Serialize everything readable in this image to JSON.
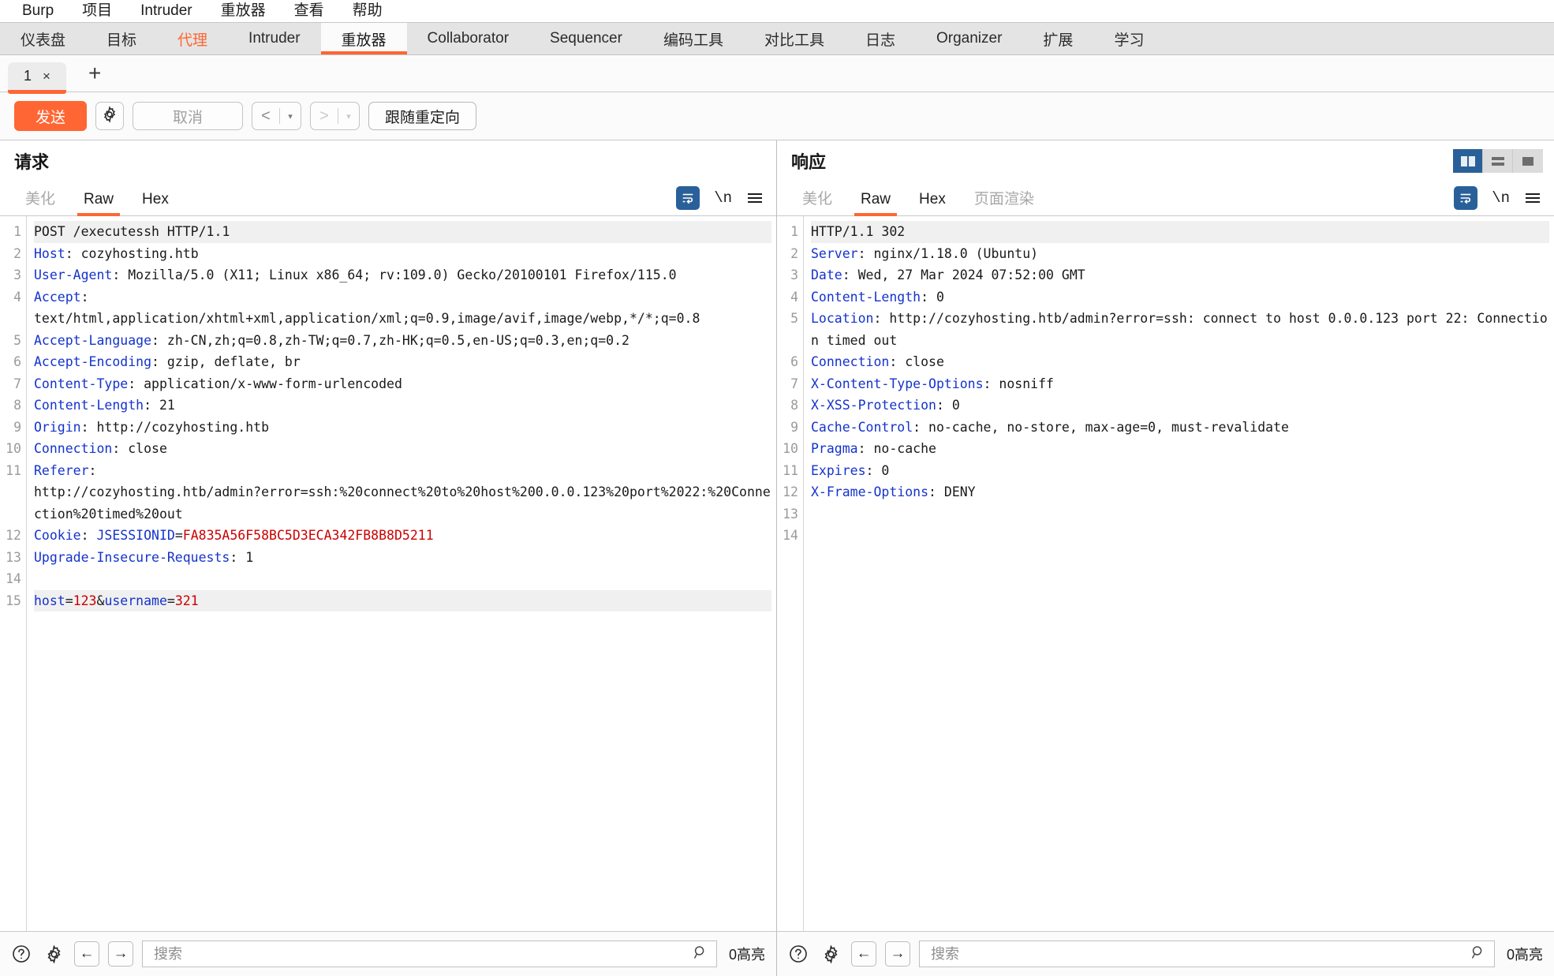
{
  "menubar": {
    "items": [
      {
        "label": "Burp"
      },
      {
        "label": "项目"
      },
      {
        "label": "Intruder"
      },
      {
        "label": "重放器"
      },
      {
        "label": "查看"
      },
      {
        "label": "帮助"
      }
    ]
  },
  "main_tabs": [
    {
      "label": "仪表盘",
      "state": "normal"
    },
    {
      "label": "目标",
      "state": "normal"
    },
    {
      "label": "代理",
      "state": "proxy"
    },
    {
      "label": "Intruder",
      "state": "normal"
    },
    {
      "label": "重放器",
      "state": "active"
    },
    {
      "label": "Collaborator",
      "state": "normal"
    },
    {
      "label": "Sequencer",
      "state": "normal"
    },
    {
      "label": "编码工具",
      "state": "normal"
    },
    {
      "label": "对比工具",
      "state": "normal"
    },
    {
      "label": "日志",
      "state": "normal"
    },
    {
      "label": "Organizer",
      "state": "normal"
    },
    {
      "label": "扩展",
      "state": "normal"
    },
    {
      "label": "学习",
      "state": "normal"
    }
  ],
  "repeater_tabs": {
    "tabs": [
      {
        "label": "1",
        "close": "×"
      }
    ],
    "add_label": "+"
  },
  "toolbar": {
    "send_label": "发送",
    "settings_icon": "gear-icon",
    "cancel_label": "取消",
    "back_caret": "▾",
    "forward_caret": "▾",
    "follow_redirect_label": "跟随重定向"
  },
  "request": {
    "title": "请求",
    "tabs": [
      {
        "label": "美化",
        "state": "muted"
      },
      {
        "label": "Raw",
        "state": "active"
      },
      {
        "label": "Hex",
        "state": "normal"
      }
    ],
    "tools": {
      "wrap_icon": "word-wrap-icon",
      "newline_label": "\\n",
      "menu_icon": "hamburger-menu-icon"
    },
    "lines": [
      {
        "n": "1",
        "hl": true,
        "parts": [
          {
            "t": "POST /executessh HTTP/1.1",
            "c": "val"
          }
        ]
      },
      {
        "n": "2",
        "parts": [
          {
            "t": "Host",
            "c": "hdr"
          },
          {
            "t": ": cozyhosting.htb",
            "c": "val"
          }
        ]
      },
      {
        "n": "3",
        "parts": [
          {
            "t": "User-Agent",
            "c": "hdr"
          },
          {
            "t": ": Mozilla/5.0 (X11; Linux x86_64; rv:109.0) Gecko/20100101 Firefox/115.0",
            "c": "val"
          }
        ]
      },
      {
        "n": "4",
        "parts": [
          {
            "t": "Accept",
            "c": "hdr"
          },
          {
            "t": ":\ntext/html,application/xhtml+xml,application/xml;q=0.9,image/avif,image/webp,*/*;q=0.8",
            "c": "val"
          }
        ]
      },
      {
        "n": "5",
        "parts": [
          {
            "t": "Accept-Language",
            "c": "hdr"
          },
          {
            "t": ": zh-CN,zh;q=0.8,zh-TW;q=0.7,zh-HK;q=0.5,en-US;q=0.3,en;q=0.2",
            "c": "val"
          }
        ]
      },
      {
        "n": "6",
        "parts": [
          {
            "t": "Accept-Encoding",
            "c": "hdr"
          },
          {
            "t": ": gzip, deflate, br",
            "c": "val"
          }
        ]
      },
      {
        "n": "7",
        "parts": [
          {
            "t": "Content-Type",
            "c": "hdr"
          },
          {
            "t": ": application/x-www-form-urlencoded",
            "c": "val"
          }
        ]
      },
      {
        "n": "8",
        "parts": [
          {
            "t": "Content-Length",
            "c": "hdr"
          },
          {
            "t": ": 21",
            "c": "val"
          }
        ]
      },
      {
        "n": "9",
        "parts": [
          {
            "t": "Origin",
            "c": "hdr"
          },
          {
            "t": ": http://cozyhosting.htb",
            "c": "val"
          }
        ]
      },
      {
        "n": "10",
        "parts": [
          {
            "t": "Connection",
            "c": "hdr"
          },
          {
            "t": ": close",
            "c": "val"
          }
        ]
      },
      {
        "n": "11",
        "parts": [
          {
            "t": "Referer",
            "c": "hdr"
          },
          {
            "t": ":\nhttp://cozyhosting.htb/admin?error=ssh:%20connect%20to%20host%200.0.0.123%20port%2022:%20Connection%20timed%20out",
            "c": "val"
          }
        ]
      },
      {
        "n": "12",
        "parts": [
          {
            "t": "Cookie",
            "c": "hdr"
          },
          {
            "t": ": ",
            "c": "val"
          },
          {
            "t": "JSESSIONID",
            "c": "blue"
          },
          {
            "t": "=",
            "c": "val"
          },
          {
            "t": "FA835A56F58BC5D3ECA342FB8B8D5211",
            "c": "red"
          }
        ]
      },
      {
        "n": "13",
        "parts": [
          {
            "t": "Upgrade-Insecure-Requests",
            "c": "hdr"
          },
          {
            "t": ": 1",
            "c": "val"
          }
        ]
      },
      {
        "n": "14",
        "parts": [
          {
            "t": "",
            "c": "val"
          }
        ]
      },
      {
        "n": "15",
        "hl": true,
        "parts": [
          {
            "t": "host",
            "c": "blue"
          },
          {
            "t": "=",
            "c": "val"
          },
          {
            "t": "123",
            "c": "red"
          },
          {
            "t": "&",
            "c": "val"
          },
          {
            "t": "username",
            "c": "blue"
          },
          {
            "t": "=",
            "c": "val"
          },
          {
            "t": "321",
            "c": "red"
          }
        ]
      }
    ],
    "status": {
      "help_icon": "help-icon",
      "settings_icon": "gear-icon",
      "prev_icon": "arrow-left-icon",
      "next_icon": "arrow-right-icon",
      "search_placeholder": "搜索",
      "search_value": "",
      "search_icon": "magnifier-icon",
      "highlight_count": "0高亮"
    }
  },
  "response": {
    "title": "响应",
    "view_modes": [
      {
        "name": "side-by-side-view",
        "state": "active"
      },
      {
        "name": "stacked-view",
        "state": "normal"
      },
      {
        "name": "single-view",
        "state": "normal"
      }
    ],
    "tabs": [
      {
        "label": "美化",
        "state": "muted"
      },
      {
        "label": "Raw",
        "state": "active"
      },
      {
        "label": "Hex",
        "state": "normal"
      },
      {
        "label": "页面渲染",
        "state": "muted"
      }
    ],
    "tools": {
      "wrap_icon": "word-wrap-icon",
      "newline_label": "\\n",
      "menu_icon": "hamburger-menu-icon"
    },
    "lines": [
      {
        "n": "1",
        "hl": true,
        "parts": [
          {
            "t": "HTTP/1.1 302",
            "c": "val"
          }
        ]
      },
      {
        "n": "2",
        "parts": [
          {
            "t": "Server",
            "c": "hdr"
          },
          {
            "t": ": nginx/1.18.0 (Ubuntu)",
            "c": "val"
          }
        ]
      },
      {
        "n": "3",
        "parts": [
          {
            "t": "Date",
            "c": "hdr"
          },
          {
            "t": ": Wed, 27 Mar 2024 07:52:00 GMT",
            "c": "val"
          }
        ]
      },
      {
        "n": "4",
        "parts": [
          {
            "t": "Content-Length",
            "c": "hdr"
          },
          {
            "t": ": 0",
            "c": "val"
          }
        ]
      },
      {
        "n": "5",
        "parts": [
          {
            "t": "Location",
            "c": "hdr"
          },
          {
            "t": ": http://cozyhosting.htb/admin?error=ssh: connect to host 0.0.0.123 port 22: Connection timed out",
            "c": "val"
          }
        ]
      },
      {
        "n": "6",
        "parts": [
          {
            "t": "Connection",
            "c": "hdr"
          },
          {
            "t": ": close",
            "c": "val"
          }
        ]
      },
      {
        "n": "7",
        "parts": [
          {
            "t": "X-Content-Type-Options",
            "c": "hdr"
          },
          {
            "t": ": nosniff",
            "c": "val"
          }
        ]
      },
      {
        "n": "8",
        "parts": [
          {
            "t": "X-XSS-Protection",
            "c": "hdr"
          },
          {
            "t": ": 0",
            "c": "val"
          }
        ]
      },
      {
        "n": "9",
        "parts": [
          {
            "t": "Cache-Control",
            "c": "hdr"
          },
          {
            "t": ": no-cache, no-store, max-age=0, must-revalidate",
            "c": "val"
          }
        ]
      },
      {
        "n": "10",
        "parts": [
          {
            "t": "Pragma",
            "c": "hdr"
          },
          {
            "t": ": no-cache",
            "c": "val"
          }
        ]
      },
      {
        "n": "11",
        "parts": [
          {
            "t": "Expires",
            "c": "hdr"
          },
          {
            "t": ": 0",
            "c": "val"
          }
        ]
      },
      {
        "n": "12",
        "parts": [
          {
            "t": "X-Frame-Options",
            "c": "hdr"
          },
          {
            "t": ": DENY",
            "c": "val"
          }
        ]
      },
      {
        "n": "13",
        "parts": [
          {
            "t": "",
            "c": "val"
          }
        ]
      },
      {
        "n": "14",
        "parts": [
          {
            "t": "",
            "c": "val"
          }
        ]
      }
    ],
    "status": {
      "help_icon": "help-icon",
      "settings_icon": "gear-icon",
      "prev_icon": "arrow-left-icon",
      "next_icon": "arrow-right-icon",
      "search_placeholder": "搜索",
      "search_value": "",
      "search_icon": "magnifier-icon",
      "highlight_count": "0高亮"
    }
  },
  "colors": {
    "accent": "#ff6633",
    "header_blue": "#1433cc",
    "value_red": "#cc0000",
    "active_blue": "#2a6099"
  }
}
